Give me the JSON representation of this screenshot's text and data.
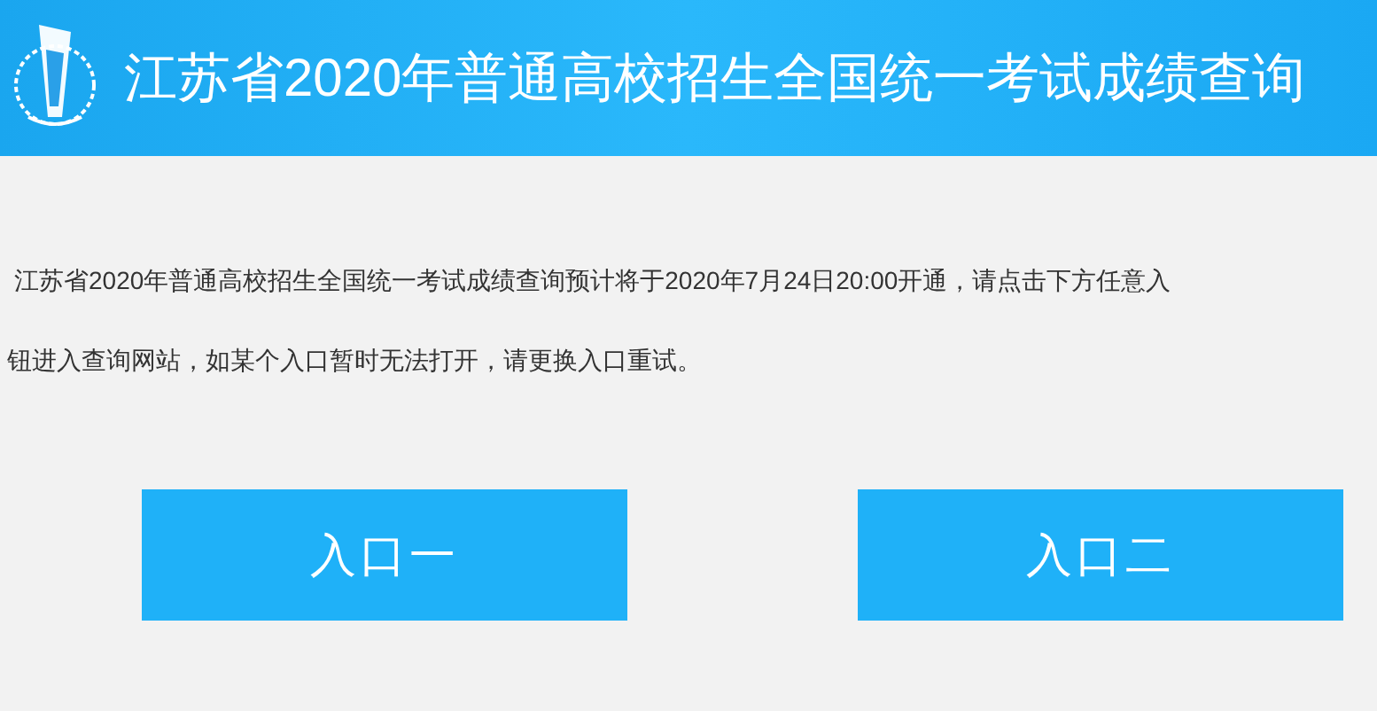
{
  "header": {
    "title": "江苏省2020年普通高校招生全国统一考试成绩查询"
  },
  "notice": {
    "lines": [
      "江苏省2020年普通高校招生全国统一考试成绩查询预计将于2020年7月24日20:00开通，请点击下方任意入",
      "钮进入查询网站，如某个入口暂时无法打开，请更换入口重试。"
    ]
  },
  "buttons": [
    {
      "label": "入口一"
    },
    {
      "label": "入口二"
    }
  ]
}
